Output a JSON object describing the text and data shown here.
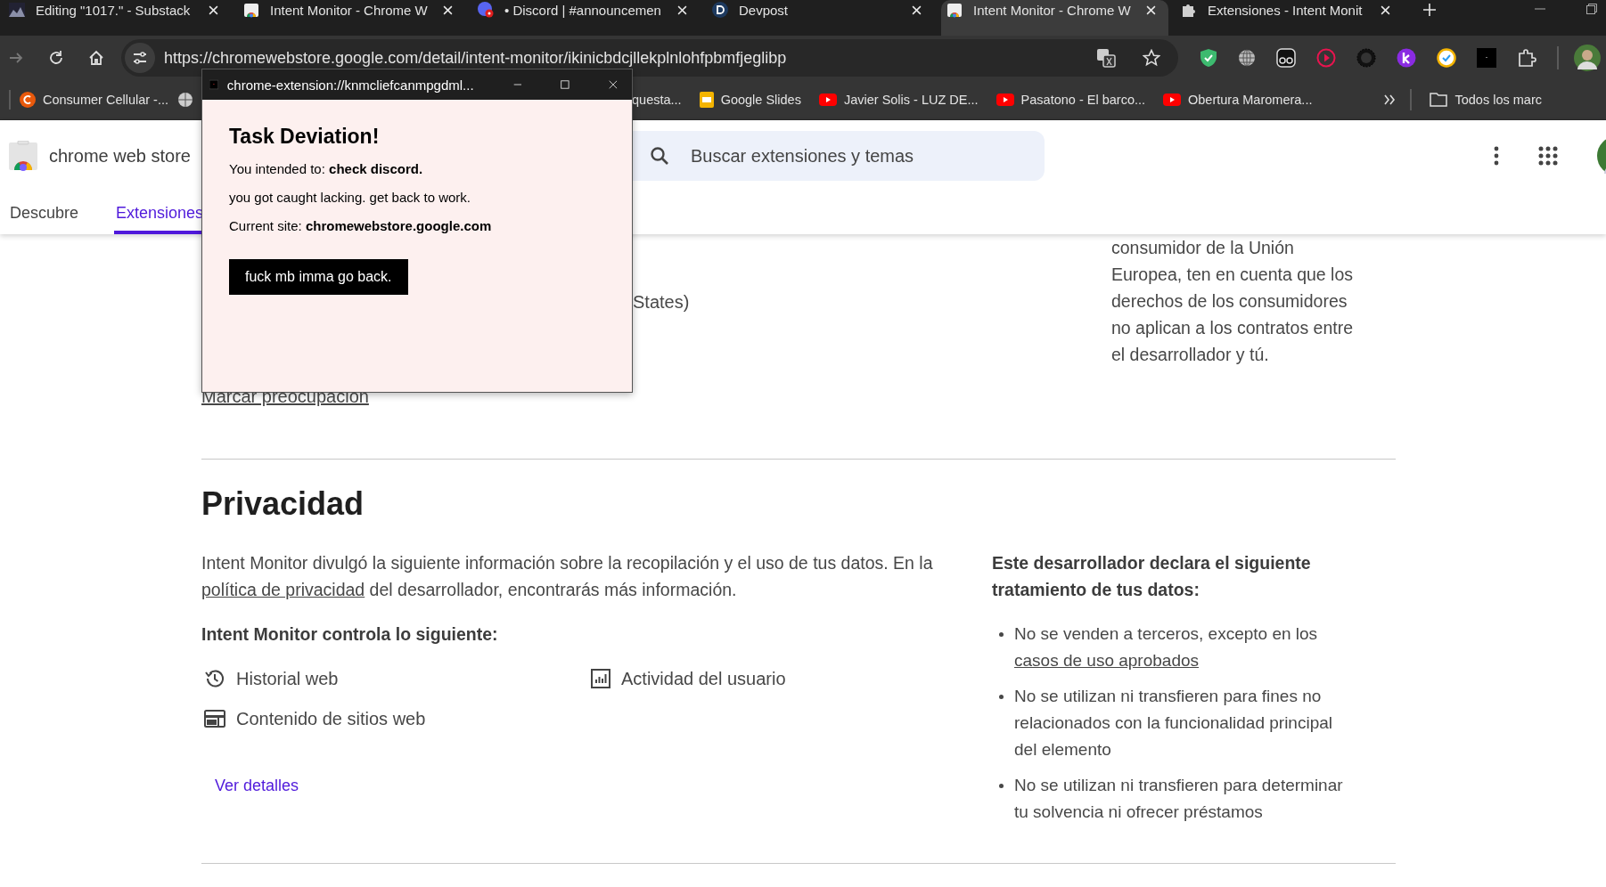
{
  "browser": {
    "tabs": [
      {
        "title": "Editing \"1017.\" - Substack",
        "selected": false
      },
      {
        "title": "Intent Monitor - Chrome W",
        "selected": false
      },
      {
        "title": "• Discord | #announcemen",
        "selected": false
      },
      {
        "title": "Devpost",
        "selected": false
      },
      {
        "title": "Intent Monitor - Chrome W",
        "selected": true
      },
      {
        "title": "Extensiones - Intent Monit",
        "selected": false
      }
    ],
    "url": "https://chromewebstore.google.com/detail/intent-monitor/ikinicbdcjllekplnlohfpbmfjeglibp",
    "bookmarks": [
      {
        "title": "Consumer Cellular -..."
      },
      {
        "title": "questa..."
      },
      {
        "title": "Google Slides"
      },
      {
        "title": "Javier Solis - LUZ DE..."
      },
      {
        "title": "Pasatono - El barco..."
      },
      {
        "title": "Obertura Maromera..."
      }
    ],
    "all_bookmarks": "Todos los marc"
  },
  "store_header": {
    "brand": "chrome web store",
    "search": {
      "placeholder": "Buscar extensiones y temas"
    },
    "nav": [
      {
        "label": "Descubre",
        "selected": false
      },
      {
        "label": "Extensiones",
        "selected": true
      }
    ]
  },
  "details": {
    "partial_text": "States)",
    "report_link": "Marcar preocupación",
    "consumer_note": "consumidor de la Unión Europea, ten en cuenta que los derechos de los consumidores no aplican a los contratos entre el desarrollador y tú."
  },
  "privacy": {
    "title": "Privacidad",
    "intro": {
      "before": "Intent Monitor divulgó la siguiente información sobre la recopilación y el uso de tus datos. En la",
      "link": "política de privacidad",
      "after": "del desarrollador, encontrarás más información."
    },
    "collects_title": "Intent Monitor controla lo siguiente:",
    "collects": [
      "Historial web",
      "Actividad del usuario",
      "Contenido de sitios web"
    ],
    "details_link": "Ver detalles",
    "declares_title": "Este desarrollador declara el siguiente tratamiento de tus datos:",
    "declares": [
      {
        "text": "No se venden a terceros, excepto en los",
        "link": "casos de uso aprobados"
      },
      {
        "text": "No se utilizan ni transfieren para fines no relacionados con la funcionalidad principal del elemento"
      },
      {
        "text": "No se utilizan ni transfieren para determinar tu solvencia ni ofrecer préstamos"
      }
    ]
  },
  "popup": {
    "title": "chrome-extension://knmcliefcanmpgdml...",
    "heading": "Task Deviation!",
    "lines": [
      "You intended to: **check discord.**",
      "you got caught lacking. get back to work.",
      "Current site: **chromewebstore.google.com**"
    ],
    "button": "fuck mb imma go back."
  }
}
